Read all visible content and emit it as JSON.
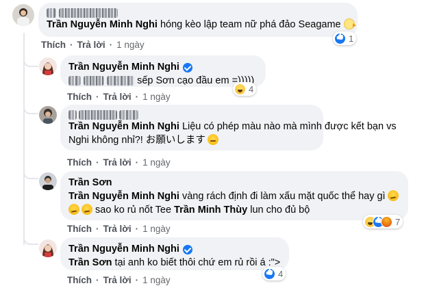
{
  "comment_main": {
    "author_blurred": true,
    "mention": "Trần Nguyễn Minh Nghi",
    "text": "hóng kèo lập team nữ phá đảo Seagame",
    "reaction_count": "1",
    "like": "Thích",
    "reply": "Trả lời",
    "time": "1 ngày"
  },
  "reply1": {
    "author": "Trần Nguyễn Minh Nghi",
    "text": "sếp Sơn cạo đầu em =)))))",
    "reaction_count": "4",
    "like": "Thích",
    "reply": "Trả lời",
    "time": "1 ngày"
  },
  "reply2": {
    "mention": "Trần Nguyễn Minh Nghi",
    "text_line1": "Liệu có phép màu nào mà mình được kết bạn vs",
    "text_line2": "Nghi không nhỉ?! お願いします",
    "like": "Thích",
    "reply": "Trả lời",
    "time": "1 ngày"
  },
  "reply3": {
    "author": "Trần Sơn",
    "mention": "Trần Nguyễn Minh Nghi",
    "text_line1": "vàng rách định đi làm xấu mặt quốc thể hay gì",
    "text_line2a": "sao ko rủ nốt Tee",
    "mention2": "Trần Minh Thùy",
    "text_line2b": "lun cho đủ bộ",
    "reaction_count": "7",
    "like": "Thích",
    "reply": "Trả lời",
    "time": "1 ngày"
  },
  "reply4": {
    "author": "Trần Nguyễn Minh Nghi",
    "mention": "Trần Sơn",
    "text": "tại anh ko biết thôi chứ em rủ rồi á :\">",
    "reaction_count": "4",
    "like": "Thích",
    "reply": "Trả lời",
    "time": "1 ngày"
  },
  "colors": {
    "bubble_bg": "#f0f2f5",
    "like_blue": "#1877f2",
    "meta_gray": "#65676b"
  },
  "icons": [
    "verified-badge-icon",
    "like-reaction-icon",
    "haha-reaction-icon",
    "angry-reaction-icon",
    "sweat-smile-emoji",
    "smirk-emoji",
    "chick-emoji"
  ]
}
